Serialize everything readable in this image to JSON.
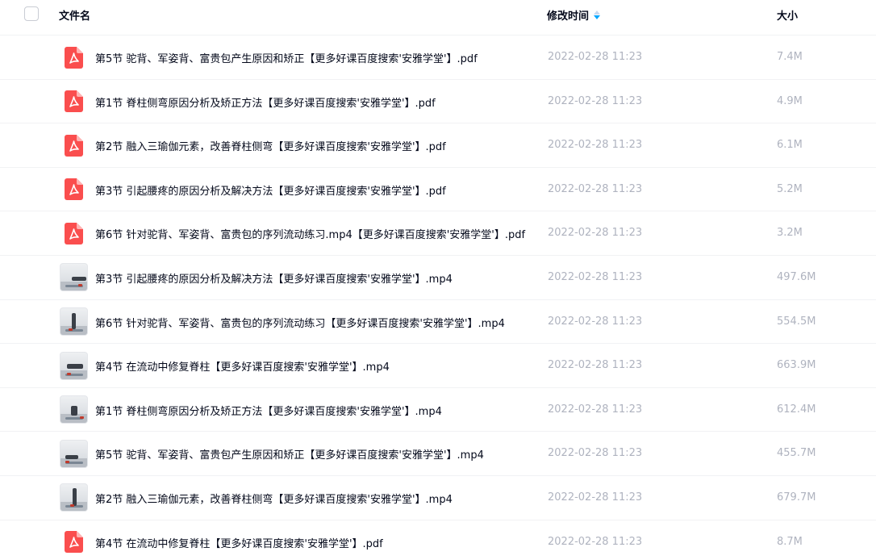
{
  "header": {
    "name_label": "文件名",
    "time_label": "修改时间",
    "size_label": "大小"
  },
  "colors": {
    "pdf_red": "#fa4e4e",
    "sort_active": "#06a7ff",
    "muted_text": "#afb3bf"
  },
  "files": [
    {
      "name": "第5节 驼背、军姿背、富贵包产生原因和矫正【更多好课百度搜索'安雅学堂'】.pdf",
      "time": "2022-02-28 11:23",
      "size": "7.4M",
      "type": "pdf-icon"
    },
    {
      "name": "第1节 脊柱侧弯原因分析及矫正方法【更多好课百度搜索'安雅学堂'】.pdf",
      "time": "2022-02-28 11:23",
      "size": "4.9M",
      "type": "pdf-icon"
    },
    {
      "name": "第2节 融入三瑜伽元素，改善脊柱侧弯【更多好课百度搜索'安雅学堂'】.pdf",
      "time": "2022-02-28 11:23",
      "size": "6.1M",
      "type": "pdf-icon"
    },
    {
      "name": "第3节 引起腰疼的原因分析及解决方法【更多好课百度搜索'安雅学堂'】.pdf",
      "time": "2022-02-28 11:23",
      "size": "5.2M",
      "type": "pdf-icon"
    },
    {
      "name": "第6节 针对驼背、军姿背、富贵包的序列流动练习.mp4【更多好课百度搜索'安雅学堂'】.pdf",
      "time": "2022-02-28 11:23",
      "size": "3.2M",
      "type": "pdf-icon"
    },
    {
      "name": "第3节 引起腰疼的原因分析及解决方法【更多好课百度搜索'安雅学堂'】.mp4",
      "time": "2022-02-28 11:23",
      "size": "497.6M",
      "type": "video-thumbnail"
    },
    {
      "name": "第6节 针对驼背、军姿背、富贵包的序列流动练习【更多好课百度搜索'安雅学堂'】.mp4",
      "time": "2022-02-28 11:23",
      "size": "554.5M",
      "type": "video-thumbnail"
    },
    {
      "name": "第4节 在流动中修复脊柱【更多好课百度搜索'安雅学堂'】.mp4",
      "time": "2022-02-28 11:23",
      "size": "663.9M",
      "type": "video-thumbnail"
    },
    {
      "name": "第1节 脊柱侧弯原因分析及矫正方法【更多好课百度搜索'安雅学堂'】.mp4",
      "time": "2022-02-28 11:23",
      "size": "612.4M",
      "type": "video-thumbnail"
    },
    {
      "name": "第5节 驼背、军姿背、富贵包产生原因和矫正【更多好课百度搜索'安雅学堂'】.mp4",
      "time": "2022-02-28 11:23",
      "size": "455.7M",
      "type": "video-thumbnail"
    },
    {
      "name": "第2节 融入三瑜伽元素，改善脊柱侧弯【更多好课百度搜索'安雅学堂'】.mp4",
      "time": "2022-02-28 11:23",
      "size": "679.7M",
      "type": "video-thumbnail"
    },
    {
      "name": "第4节 在流动中修复脊柱【更多好课百度搜索'安雅学堂'】.pdf",
      "time": "2022-02-28 11:23",
      "size": "8.7M",
      "type": "pdf-icon"
    }
  ]
}
